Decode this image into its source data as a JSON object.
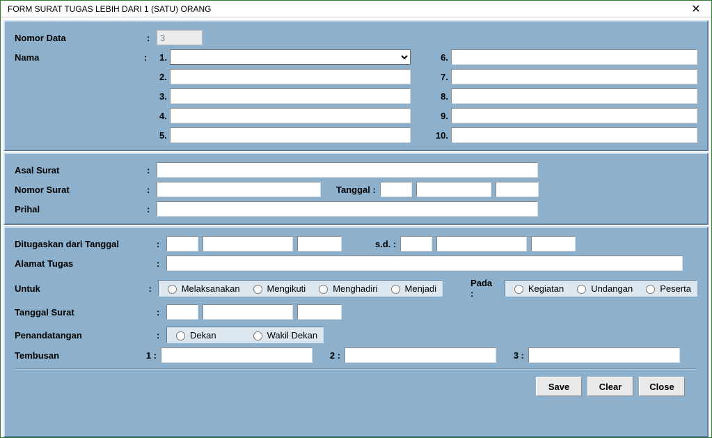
{
  "title": "FORM SURAT TUGAS LEBIH DARI 1 (SATU) ORANG",
  "section1": {
    "nomor_data_label": "Nomor Data",
    "nomor_data_value": "3",
    "nama_label": "Nama",
    "num": {
      "n1": "1.",
      "n2": "2.",
      "n3": "3.",
      "n4": "4.",
      "n5": "5.",
      "n6": "6.",
      "n7": "7.",
      "n8": "8.",
      "n9": "9.",
      "n10": "10."
    },
    "vals": {
      "v1": "",
      "v2": "",
      "v3": "",
      "v4": "",
      "v5": "",
      "v6": "",
      "v7": "",
      "v8": "",
      "v9": "",
      "v10": ""
    }
  },
  "section2": {
    "asal_surat_label": "Asal Surat",
    "asal_surat": "",
    "nomor_surat_label": "Nomor Surat",
    "nomor_surat": "",
    "tanggal_label": "Tanggal :",
    "tgl_d": "",
    "tgl_m": "",
    "tgl_y": "",
    "prihal_label": "Prihal",
    "prihal": ""
  },
  "section3": {
    "ditugaskan_label": "Ditugaskan dari Tanggal",
    "d1": "",
    "d2": "",
    "d3": "",
    "sd_label": "s.d.  :",
    "e1": "",
    "e2": "",
    "e3": "",
    "alamat_label": "Alamat Tugas",
    "alamat": "",
    "untuk_label": "Untuk",
    "untuk_opts": {
      "o1": "Melaksanakan",
      "o2": "Mengikuti",
      "o3": "Menghadiri",
      "o4": "Menjadi"
    },
    "pada_label": "Pada :",
    "pada_opts": {
      "p1": "Kegiatan",
      "p2": "Undangan",
      "p3": "Peserta"
    },
    "tglsurat_label": "Tanggal Surat",
    "ts1": "",
    "ts2": "",
    "ts3": "",
    "penandatangan_label": "Penandatangan",
    "pen_opts": {
      "q1": "Dekan",
      "q2": "Wakil Dekan"
    },
    "tembusan_label": "Tembusan",
    "tnum": {
      "t1": "1 :",
      "t2": "2 :",
      "t3": "3 :"
    },
    "tvals": {
      "tv1": "",
      "tv2": "",
      "tv3": ""
    }
  },
  "buttons": {
    "save": "Save",
    "clear": "Clear",
    "close": "Close"
  }
}
